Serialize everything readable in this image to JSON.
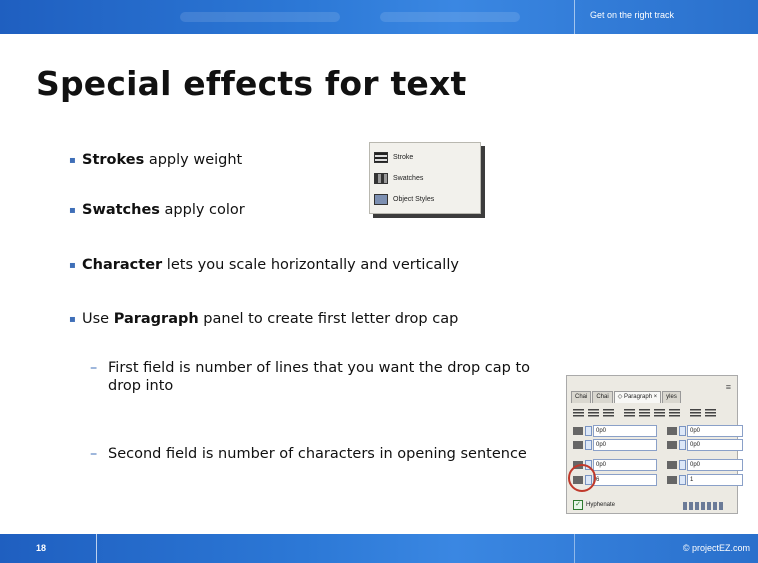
{
  "header": {
    "tagline": "Get on the right track"
  },
  "slide": {
    "title": "Special effects for text",
    "bullets": [
      {
        "strong": "Strokes",
        "text": " apply weight"
      },
      {
        "strong": "Swatches",
        "text": " apply color"
      },
      {
        "strong": "Character",
        "text": " lets you scale horizontally and vertically"
      },
      {
        "pre": "Use ",
        "strong": "Paragraph",
        "text": " panel to create first letter drop cap"
      }
    ],
    "sub_bullets": [
      "First field is number of lines that you want the drop cap to drop into",
      "Second field is number of characters in opening sentence"
    ]
  },
  "panel_menu": {
    "items": [
      "Stroke",
      "Swatches",
      "Object Styles"
    ],
    "icons": [
      "stroke-icon",
      "swatches-icon",
      "object-styles-icon"
    ]
  },
  "paragraph_panel": {
    "tabs": [
      "Chai",
      "Chai",
      "◇ Paragraph ×",
      "yles"
    ],
    "fields": {
      "left_indent": "0p0",
      "right_indent": "0p0",
      "first_line_indent": "0p0",
      "last_line_indent": "0p0",
      "space_before": "0p0",
      "space_after": "0p0",
      "drop_cap_lines": "6",
      "drop_cap_chars": "1"
    },
    "hyphenate_label": "Hyphenate",
    "hyphenate_checked": true
  },
  "footer": {
    "page_number": "18",
    "copyright": "© projectEZ.com"
  },
  "colors": {
    "bar_blue": "#2c78d6",
    "bullet_blue": "#3f6fb8",
    "highlight_red": "#c0392b"
  }
}
